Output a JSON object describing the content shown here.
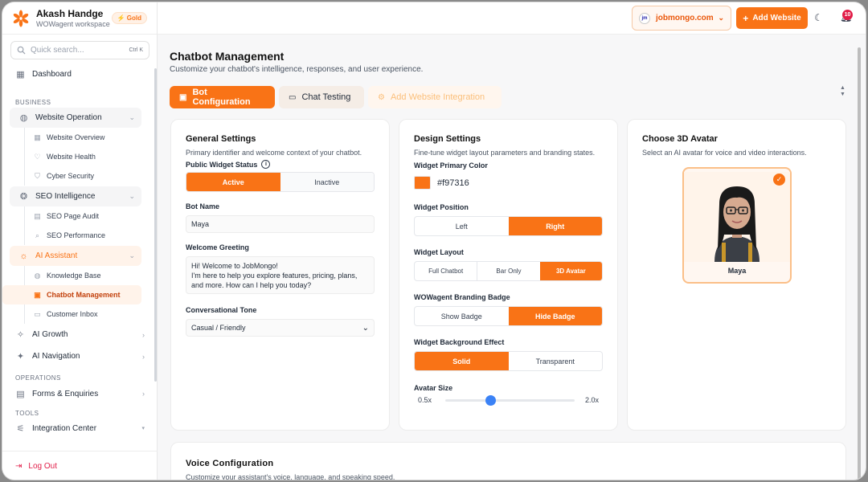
{
  "sidebar": {
    "user_name": "Akash Handge",
    "workspace": "WOWagent workspace",
    "plan_badge": "Gold",
    "search_placeholder": "Quick search...",
    "search_shortcut": "Ctrl K",
    "dashboard": "Dashboard",
    "section_business": "BUSINESS",
    "website_operation": "Website Operation",
    "website_overview": "Website Overview",
    "website_health": "Website Health",
    "cyber_security": "Cyber Security",
    "seo_intelligence": "SEO Intelligence",
    "seo_page_audit": "SEO Page Audit",
    "seo_performance": "SEO Performance",
    "ai_assistant": "AI Assistant",
    "knowledge_base": "Knowledge Base",
    "chatbot_management": "Chatbot Management",
    "customer_inbox": "Customer Inbox",
    "ai_growth": "AI Growth",
    "ai_navigation": "AI Navigation",
    "section_operations": "OPERATIONS",
    "forms_enquiries": "Forms & Enquiries",
    "section_tools": "TOOLS",
    "integration_center": "Integration Center",
    "logout": "Log Out"
  },
  "topbar": {
    "site": "jobmongo.com",
    "add_website": "Add Website",
    "notification_count": "10"
  },
  "page": {
    "title": "Chatbot Management",
    "subtitle": "Customize your chatbot's intelligence, responses, and user experience.",
    "tabs": [
      "Bot Configuration",
      "Chat Testing",
      "Add Website Integration"
    ]
  },
  "general": {
    "title": "General Settings",
    "desc": "Primary identifier and welcome context of your chatbot.",
    "status_label": "Public Widget Status",
    "status_active": "Active",
    "status_inactive": "Inactive",
    "bot_name_label": "Bot Name",
    "bot_name_value": "Maya",
    "greeting_label": "Welcome Greeting",
    "greeting_value": "Hi! Welcome to JobMongo!\nI'm here to help you explore features, pricing, plans, and more. How can I help you today?",
    "tone_label": "Conversational Tone",
    "tone_value": "Casual / Friendly"
  },
  "design": {
    "title": "Design Settings",
    "desc": "Fine-tune widget layout parameters and branding states.",
    "color_label": "Widget Primary Color",
    "color_value": "#f97316",
    "position_label": "Widget Position",
    "position_left": "Left",
    "position_right": "Right",
    "layout_label": "Widget Layout",
    "layout_full": "Full Chatbot",
    "layout_bar": "Bar Only",
    "layout_3d": "3D Avatar",
    "badge_label": "WOWagent Branding Badge",
    "badge_show": "Show Badge",
    "badge_hide": "Hide Badge",
    "bg_label": "Widget Background Effect",
    "bg_solid": "Solid",
    "bg_transparent": "Transparent",
    "size_label": "Avatar Size",
    "size_min": "0.5x",
    "size_max": "2.0x",
    "size_fraction": 0.35
  },
  "avatar": {
    "title": "Choose 3D Avatar",
    "desc": "Select an AI avatar for voice and video interactions.",
    "name": "Maya"
  },
  "voice": {
    "title": "Voice Configuration",
    "desc": "Customize your assistant's voice, language, and speaking speed."
  },
  "colors": {
    "accent": "#f97316",
    "danger": "#e11d48"
  }
}
